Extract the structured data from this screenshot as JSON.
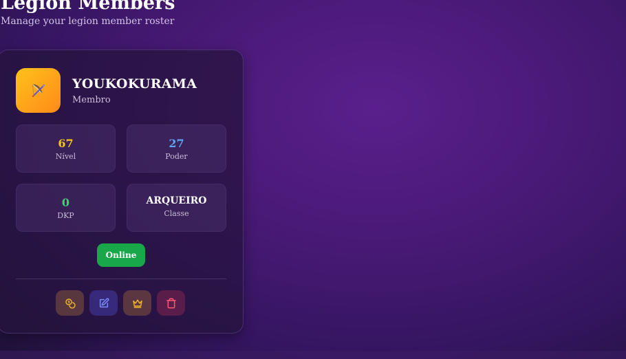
{
  "header": {
    "title": "Legion Members",
    "subtitle": "Manage your legion member roster"
  },
  "member": {
    "name": "YOUKOKURAMA",
    "role": "Membro",
    "avatar_icon": "bow-arrow-icon",
    "stats": [
      {
        "value": "67",
        "label": "Nível",
        "color": "#f5c518"
      },
      {
        "value": "27",
        "label": "Poder",
        "color": "#5aa8f0"
      },
      {
        "value": "0",
        "label": "DKP",
        "color": "#3fd17a"
      },
      {
        "value": "ARQUEIRO",
        "label": "Classe",
        "color": "#ffffff"
      }
    ],
    "status": "Online",
    "status_color": "#18a84a"
  },
  "actions": [
    {
      "icon": "coins-icon",
      "color": "#f0b429"
    },
    {
      "icon": "edit-icon",
      "color": "#7a8cff"
    },
    {
      "icon": "crown-icon",
      "color": "#f0b429"
    },
    {
      "icon": "trash-icon",
      "color": "#ff5a6e"
    }
  ]
}
